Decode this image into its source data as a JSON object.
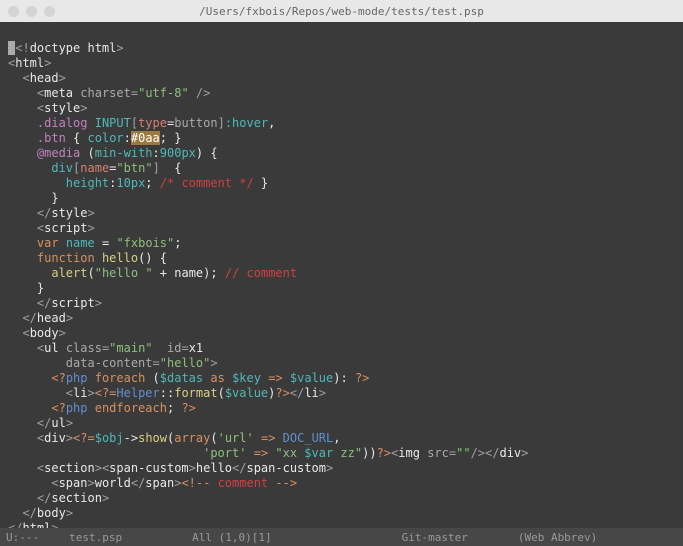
{
  "titlebar": {
    "path": "/Users/fxbois/Repos/web-mode/tests/test.psp"
  },
  "statusbar": {
    "left": "U:---",
    "file": "test.psp",
    "pos": "All (1,0)[1]",
    "vcs": "Git-master",
    "mode": "(Web Abbrev)"
  },
  "code": {
    "l01": {
      "a": "<!",
      "b": "doctype html",
      "c": ">"
    },
    "l02": {
      "a": "<",
      "b": "html",
      "c": ">"
    },
    "l03": {
      "a": "  <",
      "b": "head",
      "c": ">"
    },
    "l04": {
      "a": "    <",
      "b": "meta",
      "sp": " ",
      "attr": "charset",
      "eq": "=",
      "q": "\"",
      "val": "utf-8",
      "q2": "\"",
      "end": " />"
    },
    "l05": {
      "a": "    <",
      "b": "style",
      "c": ">"
    },
    "l06": {
      "a": "    ",
      "sel": ".dialog",
      "sp": " ",
      "sel2": "INPUT",
      "br": "[",
      "type": "type",
      "eq": "=",
      "btn": "button",
      "br2": "]",
      "hov": ":hover",
      "end": ","
    },
    "l07": {
      "a": "    ",
      "sel": ".btn",
      "sp": " ",
      "cb": "{",
      "sp2": " ",
      "prop": "color",
      "col": ":",
      "val": "#0aa",
      "sc": ";",
      "sp3": " ",
      "cbe": "}"
    },
    "l08": {
      "a": "    ",
      "at": "@media",
      "sp": " ",
      "par": "(",
      "mw": "min-with",
      "col": ":",
      "v": "900px",
      "par2": ")",
      "sp2": " ",
      "cb": "{"
    },
    "l09": {
      "a": "      ",
      "sel": "div",
      "br": "[",
      "n": "name",
      "eq": "=",
      "q": "\"",
      "v": "btn",
      "q2": "\"",
      "br2": "]",
      "sp": "  ",
      "cb": "{"
    },
    "l10": {
      "a": "        ",
      "prop": "height",
      "col": ":",
      "v": "10px",
      "sc": ";",
      "sp": " ",
      "cm": "/* comment */",
      "sp2": " ",
      "cb": "}"
    },
    "l11": {
      "a": "      ",
      "cb": "}"
    },
    "l12": {
      "a": "    </",
      "b": "style",
      "c": ">"
    },
    "l13": {
      "a": "    <",
      "b": "script",
      "c": ">"
    },
    "l14": {
      "a": "    ",
      "kw": "var",
      "sp": " ",
      "nm": "name",
      "sp2": " ",
      "eq": "=",
      "sp3": " ",
      "q": "\"",
      "v": "fxbois",
      "q2": "\"",
      "sc": ";"
    },
    "l15": {
      "a": "    ",
      "kw": "function",
      "sp": " ",
      "fn": "hello",
      "p": "()",
      "sp2": " ",
      "cb": "{"
    },
    "l16": {
      "a": "      ",
      "fn": "alert",
      "p": "(",
      "q": "\"",
      "v": "hello ",
      "q2": "\"",
      "sp": " ",
      "pl": "+",
      "sp2": " ",
      "nm": "name",
      "p2": ")",
      "sc": ";",
      "sp3": " ",
      "cm": "// comment"
    },
    "l17": {
      "a": "    ",
      "cb": "}"
    },
    "l18": {
      "a": "    </",
      "b": "script",
      "c": ">"
    },
    "l19": {
      "a": "  </",
      "b": "head",
      "c": ">"
    },
    "l20": {
      "a": "  <",
      "b": "body",
      "c": ">"
    },
    "l21": {
      "a": "    <",
      "b": "ul",
      "sp": " ",
      "at1": "class",
      "eq": "=",
      "q": "\"",
      "v1": "main",
      "q2": "\"",
      "sp2": "  ",
      "at2": "id",
      "eq2": "=",
      "v2": "x1"
    },
    "l22": {
      "a": "        ",
      "at": "data-content",
      "eq": "=",
      "q": "\"",
      "v": "hello",
      "q2": "\"",
      "c": ">"
    },
    "l23": {
      "a": "      ",
      "op": "<?",
      "lang": "php",
      "sp": " ",
      "kw": "foreach",
      "sp2": " ",
      "p": "(",
      "d": "$datas",
      "sp3": " ",
      "as": "as",
      "sp4": " ",
      "k": "$key",
      "sp5": " ",
      "ar": "=>",
      "sp6": " ",
      "val": "$value",
      "p2": ")",
      "col": ":",
      "sp7": " ",
      "cl": "?>"
    },
    "l24": {
      "a": "        <",
      "b": "li",
      "c": ">",
      "op": "<?=",
      "cls": "Helper",
      "cc": "::",
      "m": "format",
      "p": "(",
      "v": "$value",
      "p2": ")",
      "cl": "?>",
      "ce": "</",
      "b2": "li",
      "c2": ">"
    },
    "l25": {
      "a": "      ",
      "op": "<?",
      "lang": "php",
      "sp": " ",
      "kw": "endforeach",
      "sc": ";",
      "sp2": " ",
      "cl": "?>"
    },
    "l26": {
      "a": "    </",
      "b": "ul",
      "c": ">"
    },
    "l27": {
      "a": "    <",
      "b": "div",
      "c": ">",
      "op": "<?=",
      "obj": "$obj",
      "ar": "->",
      "m": "show",
      "p": "(",
      "fn": "array",
      "p2": "(",
      "q": "'",
      "k1": "url",
      "q2": "'",
      "sp": " ",
      "arr": "=>",
      "sp2": " ",
      "v1": "DOC_URL",
      "com": ","
    },
    "l28": {
      "a": "                           ",
      "q": "'",
      "k": "port",
      "q2": "'",
      "sp": " ",
      "arr": "=>",
      "sp2": " ",
      "q3": "\"",
      "v": "xx ",
      "var": "$var",
      "v2": " zz",
      "q4": "\"",
      "p": "))",
      "cl": "?>",
      "op2": "<",
      "img": "img",
      "sp3": " ",
      "at": "src",
      "eq": "=",
      "q5": "\"",
      "q6": "\"",
      "end": "/>",
      "ce": "</",
      "d": "div",
      "c": ">"
    },
    "l29": {
      "a": "    <",
      "b": "section",
      "c": ">",
      "o2": "<",
      "b2": "span-custom",
      "c2": ">",
      "t": "hello",
      "ce": "</",
      "b3": "span-custom",
      "c3": ">"
    },
    "l30": {
      "a": "      <",
      "b": "span",
      "c": ">",
      "t": "world",
      "ce": "</",
      "b2": "span",
      "c2": ">",
      "cm1": "<!--",
      "sp": " ",
      "cm2": "comment",
      "sp2": " ",
      "cm3": "-->"
    },
    "l31": {
      "a": "    </",
      "b": "section",
      "c": ">"
    },
    "l32": {
      "a": "  </",
      "b": "body",
      "c": ">"
    },
    "l33": {
      "a": "</",
      "b": "html",
      "c": ">"
    }
  }
}
